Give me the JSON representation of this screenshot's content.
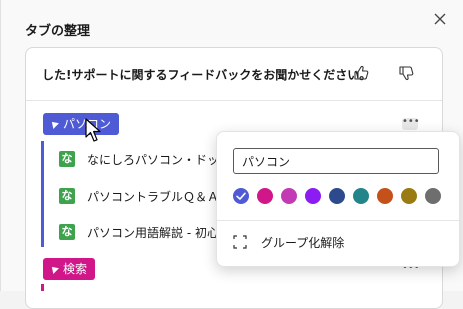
{
  "panel": {
    "title": "タブの整理"
  },
  "feedback": {
    "text": "した!サポートに関するフィードバックをお聞かせください。"
  },
  "groups": [
    {
      "name": "パソコン",
      "color": "#4f5bd5",
      "tabs": [
        {
          "title": "なにしろパソコン・ドットコム |",
          "favicon": "な"
        },
        {
          "title": "パソコントラブルＱ＆Ａ - PC",
          "favicon": "な"
        },
        {
          "title": "パソコン用語解説 - 初心者",
          "favicon": "な"
        }
      ]
    },
    {
      "name": "検索",
      "color": "#d1168a",
      "tabs": []
    }
  ],
  "group_editor": {
    "name_value": "パソコン",
    "colors": [
      "#4f5bd5",
      "#d1168a",
      "#c33bb4",
      "#8b1cf2",
      "#2d4a8c",
      "#23858a",
      "#c5511a",
      "#9a7a12",
      "#6e6e6e"
    ],
    "selected_color_index": 0,
    "ungroup_label": "グループ化解除"
  }
}
